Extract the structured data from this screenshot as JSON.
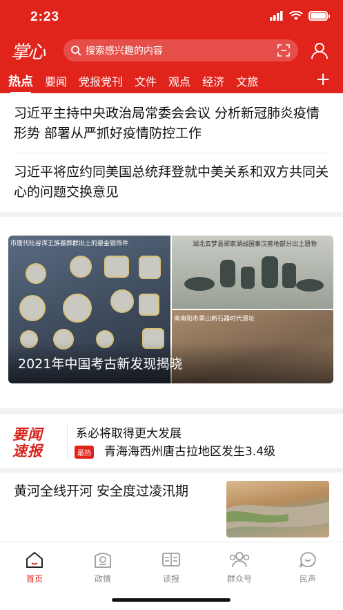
{
  "status": {
    "time": "2:23"
  },
  "header": {
    "logo": "掌心",
    "search_placeholder": "搜索感兴趣的内容",
    "tabs": [
      "热点",
      "要闻",
      "党报党刊",
      "文件",
      "观点",
      "经济",
      "文旅"
    ],
    "active_tab": "热点",
    "add_label": "+"
  },
  "headlines": [
    "习近平主持中央政治局常委会会议 分析新冠肺炎疫情形势 部署从严抓好疫情防控工作",
    "习近平将应约同美国总统拜登就中美关系和双方共同关心的问题交换意见"
  ],
  "feature": {
    "title": "2021年中国考古新发现揭晓",
    "caption_left": "市唐代吐谷浑王族墓葬群出土的鎏金银饰件",
    "caption_right_top": "湖北云梦县郑家湖战国秦汉墓地部分出土遗物",
    "caption_right_bottom": "南南阳市黄山新石器时代遗址"
  },
  "quick_news": {
    "logo_line1": "要闻",
    "logo_line2": "速报",
    "item1": "系必将取得更大发展",
    "badge": "最热",
    "item2": "青海海西州唐古拉地区发生3.4级"
  },
  "article": {
    "title": "黄河全线开河 安全度过凌汛期"
  },
  "tabbar": [
    {
      "label": "首页",
      "icon": "home-icon",
      "active": true
    },
    {
      "label": "政情",
      "icon": "government-icon",
      "active": false
    },
    {
      "label": "读报",
      "icon": "newspaper-icon",
      "active": false
    },
    {
      "label": "群众号",
      "icon": "group-icon",
      "active": false
    },
    {
      "label": "民声",
      "icon": "voice-icon",
      "active": false
    }
  ],
  "colors": {
    "brand": "#e0241c"
  }
}
